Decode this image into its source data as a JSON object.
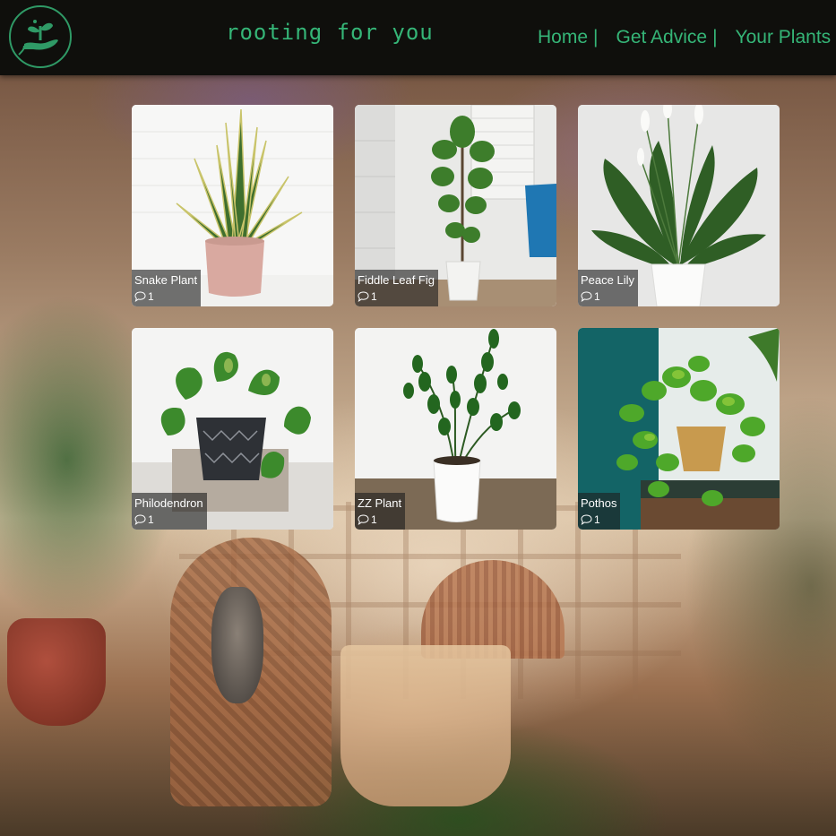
{
  "header": {
    "site_title": "rooting for you",
    "nav": [
      {
        "label": "Home",
        "separator": "|"
      },
      {
        "label": "Get Advice",
        "separator": "|"
      },
      {
        "label": "Your Plants",
        "separator": "|"
      }
    ]
  },
  "colors": {
    "accent": "#35b577",
    "header_bg": "#0f0f0c"
  },
  "plants": [
    {
      "name": "Snake Plant",
      "comments": "1",
      "icon": "comment-icon"
    },
    {
      "name": "Fiddle Leaf Fig",
      "comments": "1",
      "icon": "comment-icon"
    },
    {
      "name": "Peace Lily",
      "comments": "1",
      "icon": "comment-icon"
    },
    {
      "name": "Philodendron",
      "comments": "1",
      "icon": "comment-icon"
    },
    {
      "name": "ZZ Plant",
      "comments": "1",
      "icon": "comment-icon"
    },
    {
      "name": "Pothos",
      "comments": "1",
      "icon": "comment-icon"
    }
  ]
}
